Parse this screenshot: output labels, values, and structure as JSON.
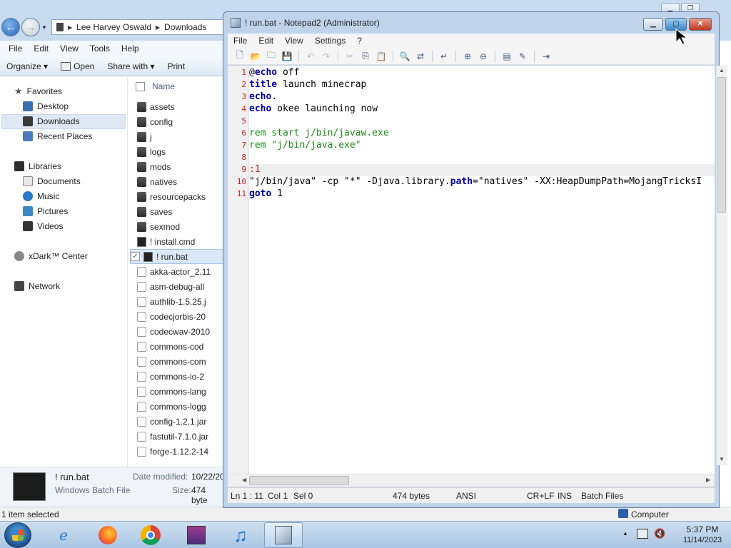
{
  "explorer": {
    "breadcrumb": [
      "Lee Harvey Oswald",
      "Downloads"
    ],
    "menu": [
      "File",
      "Edit",
      "View",
      "Tools",
      "Help"
    ],
    "toolbar": {
      "organize": "Organize ▾",
      "open": "Open",
      "share_with": "Share with ▾",
      "print": "Print"
    },
    "nav": {
      "favorites": "Favorites",
      "desktop": "Desktop",
      "downloads": "Downloads",
      "recent_places": "Recent Places",
      "libraries": "Libraries",
      "documents": "Documents",
      "music": "Music",
      "pictures": "Pictures",
      "videos": "Videos",
      "xdark": "xDark™ Center",
      "network": "Network"
    },
    "column_name": "Name",
    "files": [
      {
        "name": "assets",
        "kind": "folder"
      },
      {
        "name": "config",
        "kind": "folder"
      },
      {
        "name": "j",
        "kind": "folder"
      },
      {
        "name": "logs",
        "kind": "folder"
      },
      {
        "name": "mods",
        "kind": "folder"
      },
      {
        "name": "natives",
        "kind": "folder"
      },
      {
        "name": "resourcepacks",
        "kind": "folder"
      },
      {
        "name": "saves",
        "kind": "folder"
      },
      {
        "name": "sexmod",
        "kind": "folder"
      },
      {
        "name": "! install.cmd",
        "kind": "cmd"
      },
      {
        "name": "! run.bat",
        "kind": "cmd",
        "selected": true
      },
      {
        "name": "akka-actor_2.11",
        "kind": "jar"
      },
      {
        "name": "asm-debug-all",
        "kind": "jar"
      },
      {
        "name": "authlib-1.5.25.j",
        "kind": "jar"
      },
      {
        "name": "codecjorbis-20",
        "kind": "jar"
      },
      {
        "name": "codecwav-2010",
        "kind": "jar"
      },
      {
        "name": "commons-cod",
        "kind": "jar"
      },
      {
        "name": "commons-com",
        "kind": "jar"
      },
      {
        "name": "commons-io-2",
        "kind": "jar"
      },
      {
        "name": "commons-lang",
        "kind": "jar"
      },
      {
        "name": "commons-logg",
        "kind": "jar"
      },
      {
        "name": "config-1.2.1.jar",
        "kind": "jar"
      },
      {
        "name": "fastutil-7.1.0.jar",
        "kind": "jar"
      },
      {
        "name": "forge-1.12.2-14",
        "kind": "jar"
      }
    ],
    "details": {
      "name": "! run.bat",
      "type": "Windows Batch File",
      "date_label": "Date modified:",
      "date_value": "10/22/20",
      "size_label": "Size:",
      "size_value": "474 byte"
    },
    "status": "1 item selected",
    "computer": "Computer"
  },
  "notepad": {
    "title": "! run.bat - Notepad2 (Administrator)",
    "menu": [
      "File",
      "Edit",
      "View",
      "Settings",
      "?"
    ],
    "lines": [
      {
        "n": "1",
        "segments": [
          {
            "t": "@",
            "c": "#000"
          },
          {
            "t": "echo",
            "c": "#0000aa",
            "b": true
          },
          {
            "t": " off",
            "c": "#000"
          }
        ]
      },
      {
        "n": "2",
        "segments": [
          {
            "t": "title",
            "c": "#0000aa",
            "b": true
          },
          {
            "t": " launch minecrap",
            "c": "#000"
          }
        ]
      },
      {
        "n": "3",
        "segments": [
          {
            "t": "echo",
            "c": "#0000aa",
            "b": true
          },
          {
            "t": ".",
            "c": "#000"
          }
        ]
      },
      {
        "n": "4",
        "segments": [
          {
            "t": "echo",
            "c": "#0000aa",
            "b": true
          },
          {
            "t": " okee launching now",
            "c": "#000"
          }
        ]
      },
      {
        "n": "5",
        "segments": []
      },
      {
        "n": "6",
        "segments": [
          {
            "t": "rem start j/bin/javaw.exe",
            "c": "#1a8a1a"
          }
        ]
      },
      {
        "n": "7",
        "segments": [
          {
            "t": "rem \"j/bin/java.exe\"",
            "c": "#1a8a1a"
          }
        ]
      },
      {
        "n": "8",
        "segments": []
      },
      {
        "n": "9",
        "segments": [
          {
            "t": ":1",
            "c": "#cc2020"
          }
        ]
      },
      {
        "n": "10",
        "segments": [
          {
            "t": "\"j/bin/java\" -cp \"*\" -Djava.library.",
            "c": "#000"
          },
          {
            "t": "path",
            "c": "#0000aa",
            "b": true
          },
          {
            "t": "=\"natives\" -XX:HeapDumpPath=MojangTricksI",
            "c": "#000"
          }
        ]
      },
      {
        "n": "11",
        "segments": [
          {
            "t": "goto",
            "c": "#0000aa",
            "b": true
          },
          {
            "t": " 1",
            "c": "#000"
          }
        ]
      }
    ],
    "status": {
      "position": "Ln 1 : 11",
      "col": "Col 1",
      "sel": "Sel 0",
      "bytes": "474 bytes",
      "encoding": "ANSI",
      "eol": "CR+LF",
      "ins": "INS",
      "scheme": "Batch Files"
    }
  },
  "taskbar": {
    "time": "5:37 PM",
    "date": "11/14/2023"
  }
}
